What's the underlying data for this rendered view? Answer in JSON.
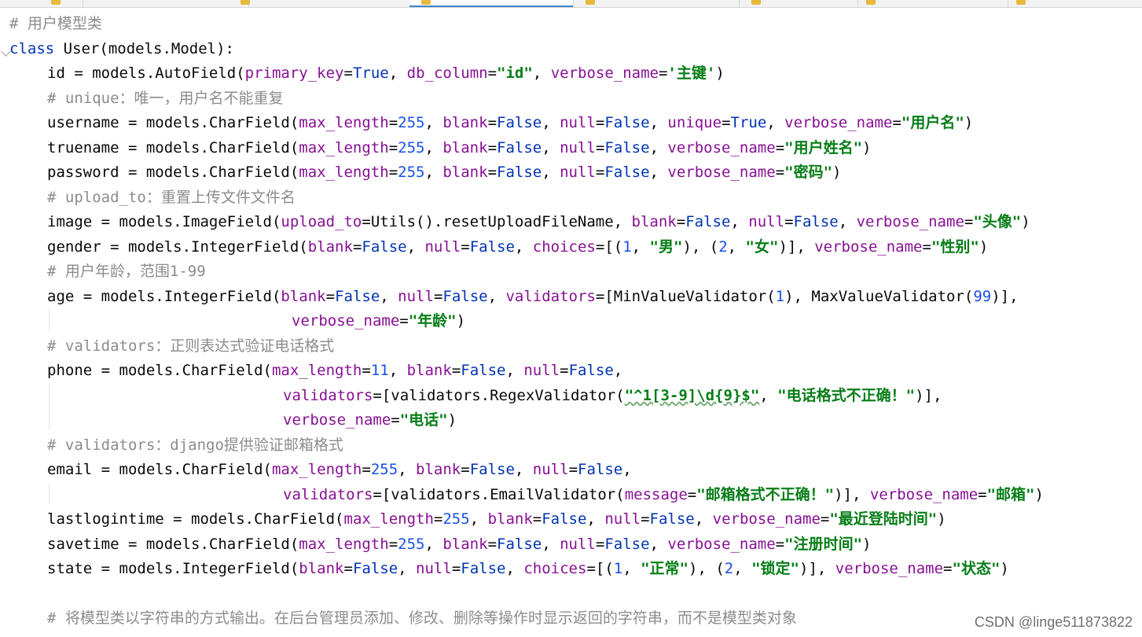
{
  "tabs": [
    {
      "label": "",
      "active": false
    },
    {
      "label": "",
      "active": false
    },
    {
      "label": "",
      "active": true
    },
    {
      "label": "",
      "active": false
    },
    {
      "label": "",
      "active": false
    },
    {
      "label": "",
      "active": false
    },
    {
      "label": "",
      "active": false
    }
  ],
  "code": {
    "l01": "# 用户模型类",
    "l02": "class User(models.Model):",
    "l03": "id = models.AutoField(primary_key=True, db_column=\"id\", verbose_name='主键')",
    "l04": "# unique：唯一，用户名不能重复",
    "l05": "username = models.CharField(max_length=255, blank=False, null=False, unique=True, verbose_name=\"用户名\")",
    "l06": "truename = models.CharField(max_length=255, blank=False, null=False, verbose_name=\"用户姓名\")",
    "l07": "password = models.CharField(max_length=255, blank=False, null=False, verbose_name=\"密码\")",
    "l08": "# upload_to：重置上传文件文件名",
    "l09": "image = models.ImageField(upload_to=Utils().resetUploadFileName, blank=False, null=False, verbose_name=\"头像\")",
    "l10": "gender = models.IntegerField(blank=False, null=False, choices=[(1, \"男\"), (2, \"女\")], verbose_name=\"性别\")",
    "l11": "# 用户年龄，范围1-99",
    "l12": "age = models.IntegerField(blank=False, null=False, validators=[MinValueValidator(1), MaxValueValidator(99)],",
    "l13": "verbose_name=\"年龄\")",
    "l14": "# validators：正则表达式验证电话格式",
    "l15": "phone = models.CharField(max_length=11, blank=False, null=False,",
    "l16": "validators=[validators.RegexValidator(\"^1[3-9]\\d{9}$\", \"电话格式不正确！\")],",
    "l17": "verbose_name=\"电话\")",
    "l18": "# validators：django提供验证邮箱格式",
    "l19": "email = models.CharField(max_length=255, blank=False, null=False,",
    "l20": "validators=[validators.EmailValidator(message=\"邮箱格式不正确！\")], verbose_name=\"邮箱\")",
    "l21": "lastlogintime = models.CharField(max_length=255, blank=False, null=False, verbose_name=\"最近登陆时间\")",
    "l22": "savetime = models.CharField(max_length=255, blank=False, null=False, verbose_name=\"注册时间\")",
    "l23": "state = models.IntegerField(blank=False, null=False, choices=[(1, \"正常\"), (2, \"锁定\")], verbose_name=\"状态\")",
    "l24": "",
    "l25": "# 将模型类以字符串的方式输出。在后台管理员添加、修改、删除等操作时显示返回的字符串，而不是模型类对象"
  },
  "watermark": "CSDN @linge511873822",
  "colors": {
    "comment": "#8c8c8c",
    "keyword": "#0033b3",
    "param": "#871094",
    "string": "#067d17",
    "number": "#1750eb",
    "tab_accent": "#4083c9"
  }
}
